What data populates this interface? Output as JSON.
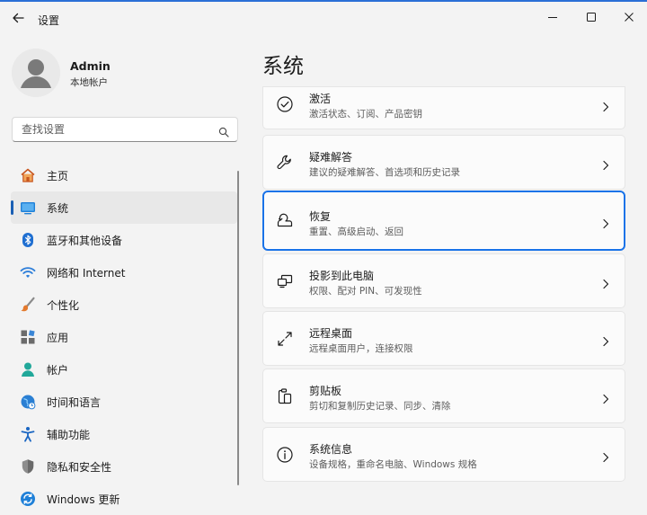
{
  "window": {
    "title": "设置"
  },
  "account": {
    "name": "Admin",
    "type": "本地帐户"
  },
  "search": {
    "placeholder": "查找设置"
  },
  "nav": {
    "items": [
      {
        "label": "主页"
      },
      {
        "label": "系统"
      },
      {
        "label": "蓝牙和其他设备"
      },
      {
        "label": "网络和 Internet"
      },
      {
        "label": "个性化"
      },
      {
        "label": "应用"
      },
      {
        "label": "帐户"
      },
      {
        "label": "时间和语言"
      },
      {
        "label": "辅助功能"
      },
      {
        "label": "隐私和安全性"
      },
      {
        "label": "Windows 更新"
      }
    ]
  },
  "main": {
    "title": "系统",
    "cards": [
      {
        "title": "激活",
        "subtitle": "激活状态、订阅、产品密钥",
        "icon": "activation-check-icon"
      },
      {
        "title": "疑难解答",
        "subtitle": "建议的疑难解答、首选项和历史记录",
        "icon": "wrench-icon"
      },
      {
        "title": "恢复",
        "subtitle": "重置、高级启动、返回",
        "icon": "recovery-icon"
      },
      {
        "title": "投影到此电脑",
        "subtitle": "权限、配对 PIN、可发现性",
        "icon": "projection-icon"
      },
      {
        "title": "远程桌面",
        "subtitle": "远程桌面用户，连接权限",
        "icon": "remote-desktop-icon"
      },
      {
        "title": "剪贴板",
        "subtitle": "剪切和复制历史记录、同步、清除",
        "icon": "clipboard-icon"
      },
      {
        "title": "系统信息",
        "subtitle": "设备规格，重命名电脑、Windows 规格",
        "icon": "info-icon"
      }
    ]
  },
  "colors": {
    "accent": "#1a5fb4",
    "focus": "#1a73e8",
    "background": "#f3f3f3",
    "card": "#fbfbfb"
  }
}
